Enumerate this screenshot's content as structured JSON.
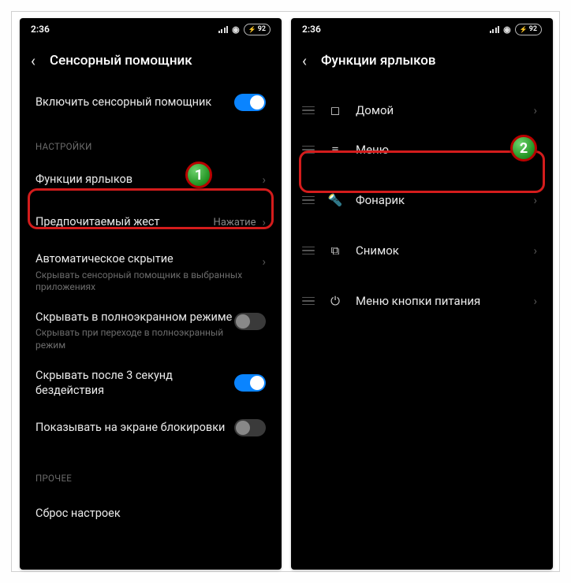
{
  "statusbar": {
    "time": "2:36",
    "battery": "92"
  },
  "callouts": {
    "one": "1",
    "two": "2"
  },
  "left": {
    "title": "Сенсорный помощник",
    "enable_label": "Включить сенсорный помощник",
    "section_settings": "НАСТРОЙКИ",
    "shortcuts_label": "Функции ярлыков",
    "gesture_label": "Предпочитаемый жест",
    "gesture_value": "Нажатие",
    "autohide_label": "Автоматическое скрытие",
    "autohide_sub": "Скрывать сенсорный помощник в выбранных приложениях",
    "fullscreen_label": "Скрывать в полноэкранном режиме",
    "fullscreen_sub": "Скрывать при переходе в полноэкранный режим",
    "hide3s_label": "Скрывать после 3 секунд бездействия",
    "lockscreen_label": "Показывать на экране блокировки",
    "section_other": "ПРОЧЕЕ",
    "reset_label": "Сброс настроек"
  },
  "right": {
    "title": "Функции ярлыков",
    "items": [
      {
        "icon": "home",
        "label": "Домой"
      },
      {
        "icon": "menu",
        "label": "Меню"
      },
      {
        "icon": "torch",
        "label": "Фонарик"
      },
      {
        "icon": "shot",
        "label": "Снимок"
      },
      {
        "icon": "power",
        "label": "Меню кнопки питания"
      }
    ]
  }
}
